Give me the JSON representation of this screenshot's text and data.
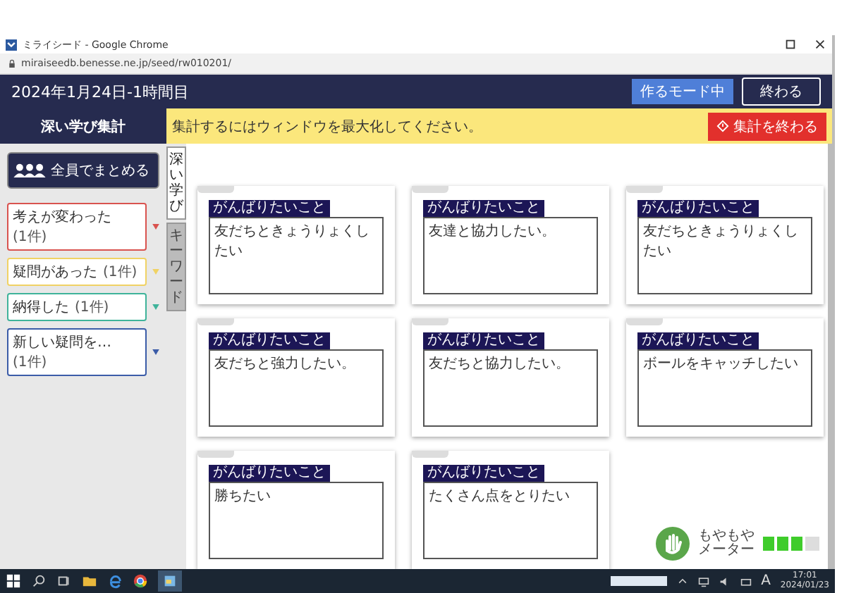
{
  "browser": {
    "title": "ミライシード - Google Chrome",
    "url": "miraiseedb.benesse.ne.jp/seed/rw010201/"
  },
  "header": {
    "title": "2024年1月24日-1時間目",
    "mode_button": "作るモード中",
    "end_button": "終わる"
  },
  "sidebar": {
    "title": "深い学び集計",
    "group_button": "全員でまとめる",
    "filters": [
      {
        "label": "考えが変わった",
        "count": "(1件)",
        "color": "#d9534f"
      },
      {
        "label": "疑問があった",
        "count": "(1件)",
        "color": "#f0d264"
      },
      {
        "label": "納得した",
        "count": "(1件)",
        "color": "#3fb39a"
      },
      {
        "label": "新しい疑問を…",
        "count": "(1件)",
        "color": "#3b5ca8"
      }
    ]
  },
  "vertical_tabs": [
    {
      "label": "深い学び",
      "selected": true
    },
    {
      "label": "キーワード",
      "selected": false
    }
  ],
  "banner": {
    "message": "集計するにはウィンドウを最大化してください。",
    "button": "集計を終わる"
  },
  "cards": [
    {
      "tag": "がんばりたいこと",
      "text": "友だちときょうりょくしたい"
    },
    {
      "tag": "がんばりたいこと",
      "text": "友達と協力したい。"
    },
    {
      "tag": "がんばりたいこと",
      "text": "友だちときょうりょくしたい"
    },
    {
      "tag": "がんばりたいこと",
      "text": "友だちと強力したい。"
    },
    {
      "tag": "がんばりたいこと",
      "text": "友だちと協力したい。"
    },
    {
      "tag": "がんばりたいこと",
      "text": "ボールをキャッチしたい"
    },
    {
      "tag": "がんばりたいこと",
      "text": "勝ちたい"
    },
    {
      "tag": "がんばりたいこと",
      "text": "たくさん点をとりたい"
    }
  ],
  "meter": {
    "lines": [
      "もやもや",
      "メーター"
    ],
    "level": 0.75
  },
  "taskbar": {
    "ime": "A",
    "time": "17:01",
    "date": "2024/01/23"
  }
}
